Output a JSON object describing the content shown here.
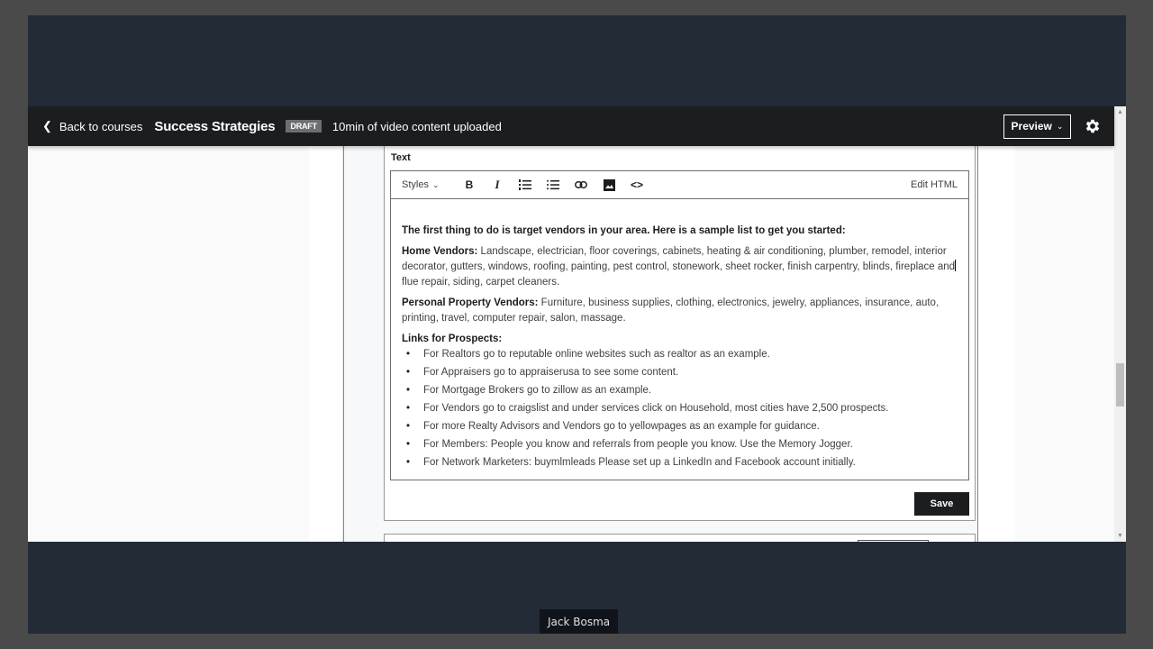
{
  "topbar": {
    "back_label": "Back to courses",
    "course_title": "Success Strategies",
    "status_badge": "DRAFT",
    "upload_status": "10min of video content uploaded",
    "preview_label": "Preview"
  },
  "editor": {
    "field_label": "Text",
    "toolbar": {
      "styles_label": "Styles",
      "bold_label": "B",
      "italic_label": "I",
      "edit_html_label": "Edit HTML"
    },
    "intro": "The first thing to do is target vendors in your area. Here is a sample list to get you started:",
    "home_vendors_label": "Home Vendors:",
    "home_vendors_text_a": " Landscape, electrician, floor coverings, cabinets, heating & air conditioning, plumber, remodel, interior decorator, gutters, windows, roofing, painting, pest control, stonework, sheet rocker, finish carpentry, blinds, fireplace and",
    "home_vendors_text_b": " flue repair, siding, carpet cleaners.",
    "personal_vendors_label": "Personal Property Vendors:",
    "personal_vendors_text": " Furniture, business supplies, clothing, electronics, jewelry, appliances, insurance, auto, printing, travel, computer repair, salon, massage.",
    "links_heading": "Links for Prospects:",
    "links": [
      "For Realtors go to reputable online websites such as realtor as an example.",
      "For Appraisers go to appraiserusa to see some content.",
      "For Mortgage Brokers go to zillow as an example.",
      "For Vendors go to craigslist and under services click on Household, most cities have 2,500 prospects.",
      "For more Realty Advisors and Vendors go to yellowpages as an example for guidance.",
      "For Members: People you know and referrals from people you know. Use the Memory Jogger.",
      "For Network Marketers: buymlmleads Please set up a LinkedIn and Facebook account initially."
    ],
    "save_label": "Save"
  },
  "caption": {
    "speaker": "Jack Bosma"
  }
}
